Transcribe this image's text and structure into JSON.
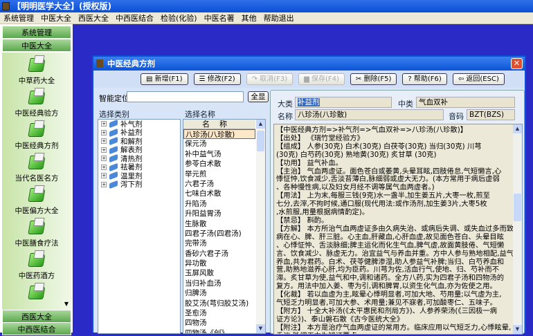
{
  "app": {
    "title": "【明明医学大全】(授权版)"
  },
  "menu": [
    "系统管理",
    "中医大全",
    "西医大全",
    "中西医结合",
    "检验(化验)",
    "中医名著",
    "其他",
    "帮助退出"
  ],
  "sidebar": {
    "headers": [
      "系统管理",
      "中医大全"
    ],
    "items": [
      "中草药大全",
      "中医经典验方",
      "中医经典方剂",
      "当代名医名方",
      "中医偏方大全",
      "中医膳食疗法",
      "中医药酒方"
    ],
    "bottom": [
      "西医大全",
      "中西医结合"
    ]
  },
  "dialog": {
    "title": "中医经典方剂",
    "toolbar": [
      "新增(F1)",
      "修改(F2)",
      "取消(F3)",
      "保存(F4)",
      "删除(F5)",
      "帮助(F6)",
      "返回(ESC)"
    ],
    "search_label": "智能定位",
    "search_value": "",
    "show_all": "全显",
    "category_label": "选择类别",
    "name_label": "选择名称",
    "categories": [
      "补气剂",
      "补益剂",
      "和解剂",
      "解表剂",
      "清热剂",
      "祛暑剂",
      "温里剂",
      "泻下剂"
    ],
    "names_header": "名称",
    "names": [
      "八珍汤(八珍散)",
      "保元汤",
      "补中益气汤",
      "参苓白术散",
      "举元煎",
      "六君子汤",
      "七味白术散",
      "升陷汤",
      "升阳益胃汤",
      "生脉散",
      "四君子汤(四君汤)",
      "完带汤",
      "香砂六君子汤",
      "异功散",
      "玉屏风散",
      "当归补血汤",
      "归脾汤",
      "胶艾汤(芎归胶艾汤)",
      "圣愈汤",
      "四物汤",
      "四物汤《创》"
    ],
    "selected_name": "八珍汤(八珍散)",
    "fields": {
      "major_label": "大类",
      "major_value": "补益剂",
      "mid_label": "中类",
      "mid_value": "气血双补",
      "name_label": "名称",
      "name_value": "八珍汤(八珍散)",
      "code_label": "音码",
      "code_value": "BZT(BZS)"
    },
    "content_lines": [
      "【中医经典方剂=>补气剂=>气血双补=>八珍汤(八珍散)】",
      "【出处】 《瑞竹堂经验方》",
      "【组成】 人参(30克) 白术(30克) 白茯苓(30克) 当归(30克) 川芎",
      "(30克) 白芍药(30克) 熟地黄(30克) 炙甘草 (30克)",
      "【功用】 益气补血。",
      "【主治】 气血两虚证。面色苍白或萎黄,头晕耳眩,四肢倦怠,气短懒言,心",
      "悸怔忡,饮食减少,舌淡苔薄白,脉细弱或虚大无力。(本方常用于病后虚弱",
      "、各种慢性病,以及妇女月经不调等属气血两虚者。)",
      "【用法】 上为末,每服三钱(9克)水一盏半,加生姜五片,大枣一枚,煎至",
      "七分,去滓,不拘时候,通口服(现代用法:或作汤剂,加生姜3片,大枣5枚",
      ",水煎服,用量根据病情酌定)。",
      "【禁忌】 斟酌。",
      "【方解】 本方所治气血两虚证多由久病失治、或病后失调、或失血过多而致,",
      "病在心、脾、肝三脏。心主血,肝藏血,心肝血虚,故见面色苍白、头晕目眩",
      "、心悸怔忡、舌淡脉细;脾主运化而化生气血,脾气虚,故面黄肢倦、气短懒",
      "言、饮食减少、脉虚无力。治宜益气与养血并重。方中人参与熟地相配,益气",
      "养血,共为君药。白术、茯苓健脾渗湿,助人参益气补脾;当归、白芍养血和",
      "营,助熟地滋养心肝,均为臣药。川芎为佐,活血行气,使地、归、芍补而不",
      "滞。炙甘草为使,益气和中,调和诸药。全方八药,实为四君子汤和四物汤的",
      "复方。用法中加入姜、枣为引,调和脾胃,以资生化气血,亦为佐使之用。",
      "【化裁】 若以血虚为主,眩晕心悸明显者,可加大地、芍用量;以气虚为主,",
      "气短乏力明显者,可加大参、术用量;兼见不寐者,可加酸枣仁、五味子。",
      "【附方】 十全大补汤(《太平惠民和剂局方》)、人参养荣汤(《三因极一病",
      "证方论》)、泰山磐石散《古今医统大全》",
      "【附注】 本方是治疗气血两虚证的常用方。临床应用以气短乏力,心悸眩晕,",
      "舌淡,脉细无力为辨证要点。"
    ]
  }
}
